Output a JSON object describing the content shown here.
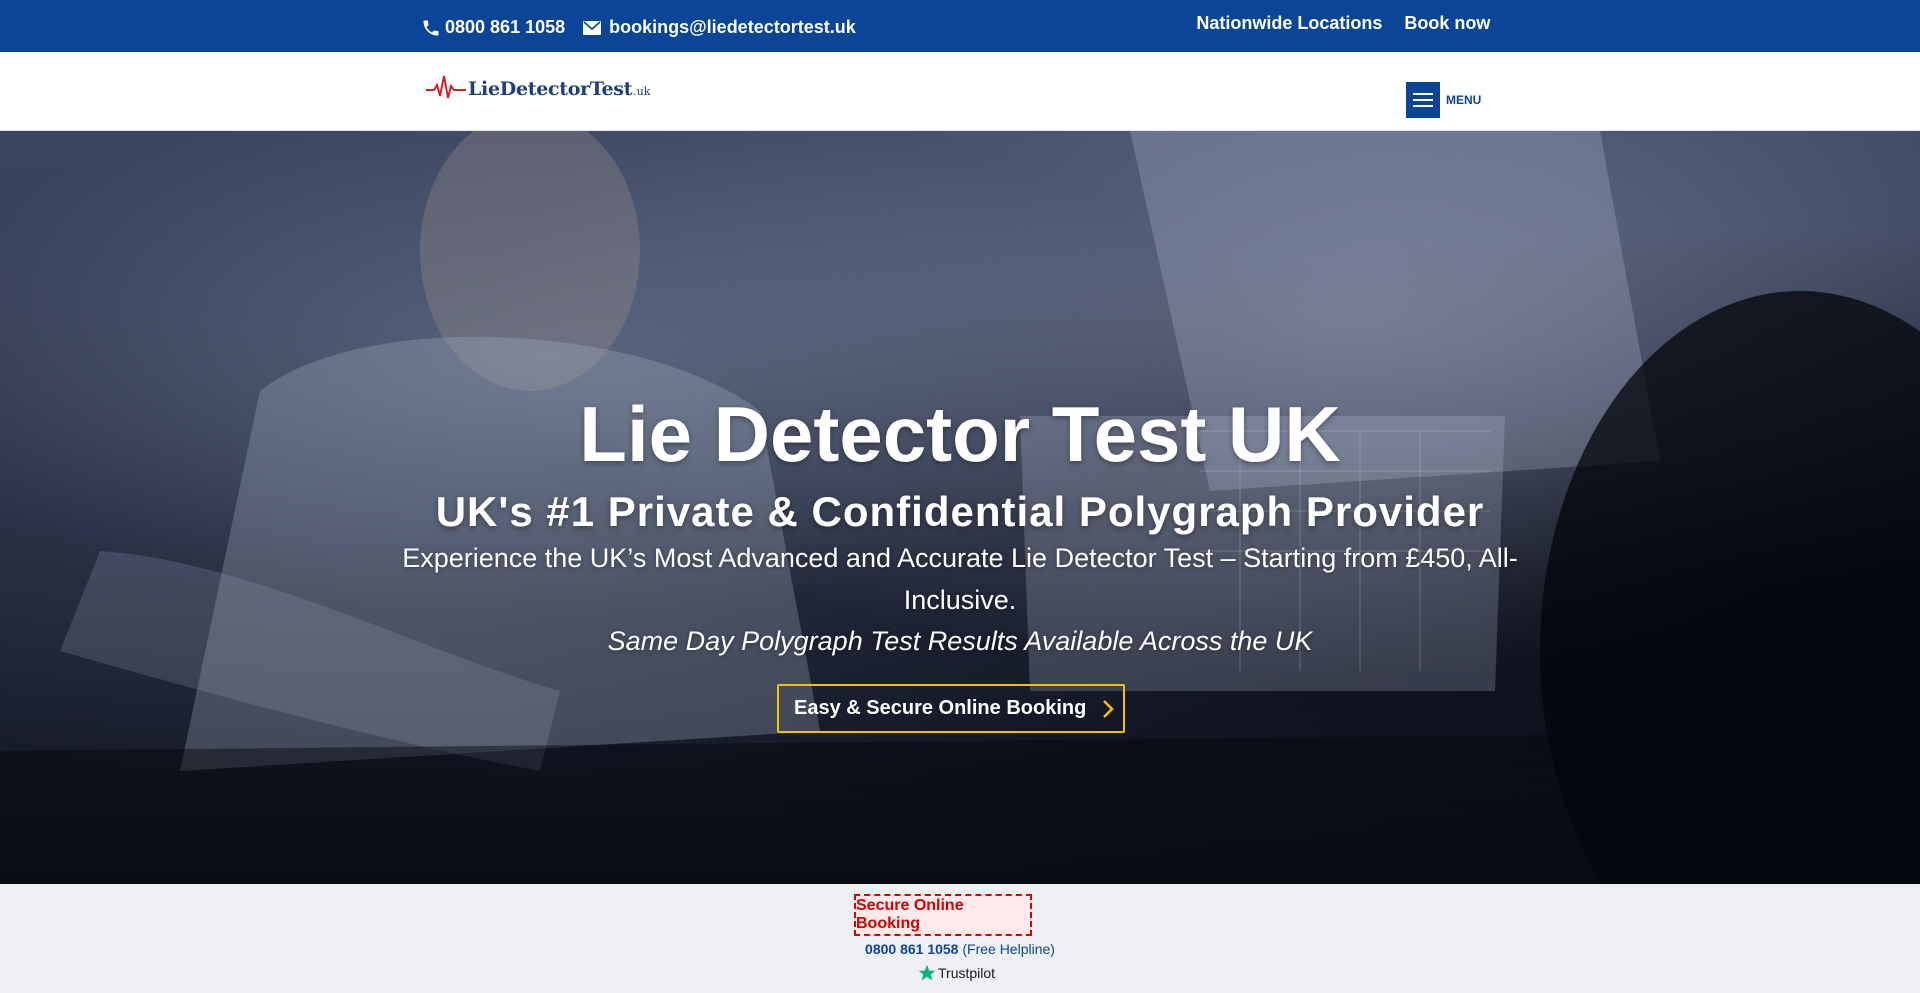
{
  "topbar": {
    "phone": "0800 861 1058",
    "email": "bookings@liedetectortest.uk",
    "links": [
      "Nationwide Locations",
      "Book now  "
    ]
  },
  "header": {
    "logo_text": "LieDetectorTest",
    "logo_suffix": ".uk",
    "menu_label": "MENU"
  },
  "hero": {
    "title": "Lie Detector Test UK",
    "subtitle": "UK's #1 Private & Confidential Polygraph Provider",
    "lead": "Experience the UK’s Most Advanced and Accurate Lie Detector Test – Starting from £450, All-Inclusive.",
    "tagline": "Same Day Polygraph Test Results Available Across the UK",
    "cta_label": "Easy & Secure Online Booking"
  },
  "strip": {
    "secure_label": "Secure Online Booking",
    "helpline_number": "0800 861 1058",
    "helpline_note": " (Free Helpline)",
    "trustpilot": "Trustpilot"
  },
  "colors": {
    "brand_blue": "#0a4597",
    "cta_border": "#f2c200",
    "alert_red": "#d40000",
    "trustpilot_green": "#00b67a"
  },
  "icons": [
    "phone-icon",
    "envelope-icon",
    "hamburger-icon",
    "chevron-right-icon",
    "trustpilot-star-icon"
  ]
}
